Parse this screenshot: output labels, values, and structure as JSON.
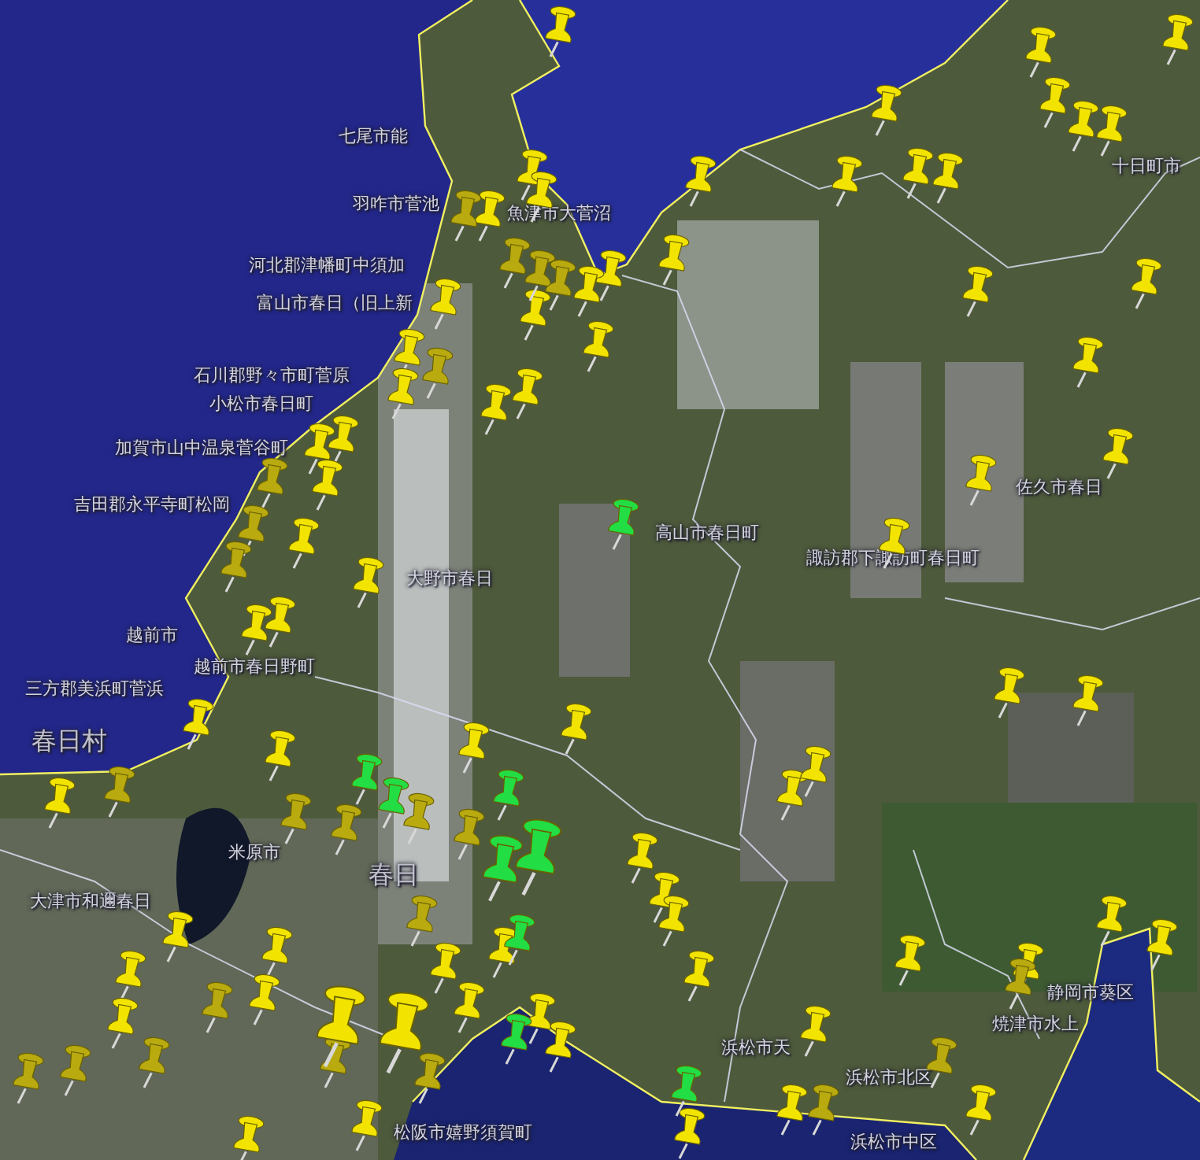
{
  "labels": [
    {
      "text": "七尾市能"
    },
    {
      "text": "羽咋市菅池"
    },
    {
      "text": "魚津市大菅沼"
    },
    {
      "text": "河北郡津幡町中須加"
    },
    {
      "text": "富山市春日（旧上新"
    },
    {
      "text": "石川郡野々市町菅原"
    },
    {
      "text": "小松市春日町"
    },
    {
      "text": "加賀市山中温泉菅谷町"
    },
    {
      "text": "吉田郡永平寺町松岡"
    },
    {
      "text": "大野市春日"
    },
    {
      "text": "越前市"
    },
    {
      "text": "越前市春日野町"
    },
    {
      "text": "三方郡美浜町菅浜"
    },
    {
      "text": "春日村"
    },
    {
      "text": "米原市"
    },
    {
      "text": "春日"
    },
    {
      "text": "大津市和邇春日"
    },
    {
      "text": "高山市春日町"
    },
    {
      "text": "諏訪郡下諏訪町春日町"
    },
    {
      "text": "佐久市春日"
    },
    {
      "text": "十日町市"
    },
    {
      "text": "焼津市水上"
    },
    {
      "text": "浜松市天"
    },
    {
      "text": "浜松市北区"
    },
    {
      "text": "浜松市中区"
    },
    {
      "text": "静岡市葵区"
    },
    {
      "text": "松阪市嬉野須賀町"
    }
  ],
  "pins": [
    {
      "color": "#f2e400"
    },
    {
      "color": "#f2e400"
    },
    {
      "color": "#f2e400"
    },
    {
      "color": "#f2e400"
    },
    {
      "color": "#f2e400"
    },
    {
      "color": "#f2e400"
    },
    {
      "color": "#f2e400"
    },
    {
      "color": "#f2e400"
    },
    {
      "color": "#f2e400"
    },
    {
      "color": "#f2e400"
    },
    {
      "color": "#f2e400"
    },
    {
      "color": "#f2e400"
    },
    {
      "color": "#f2e400"
    },
    {
      "color": "#f2e400"
    },
    {
      "color": "#f2e400"
    },
    {
      "color": "#f2e400"
    },
    {
      "color": "#f2e400"
    },
    {
      "color": "#f2e400"
    },
    {
      "color": "#f2e400"
    },
    {
      "color": "#f2e400"
    },
    {
      "color": "#f2e400"
    },
    {
      "color": "#f2e400"
    },
    {
      "color": "#f2e400"
    },
    {
      "color": "#f2e400"
    },
    {
      "color": "#f2e400"
    },
    {
      "color": "#f2e400"
    },
    {
      "color": "#f2e400"
    },
    {
      "color": "#f2e400"
    },
    {
      "color": "#f2e400"
    },
    {
      "color": "#f2e400"
    },
    {
      "color": "#f2e400"
    },
    {
      "color": "#f2e400"
    },
    {
      "color": "#f2e400"
    },
    {
      "color": "#f2e400"
    },
    {
      "color": "#f2e400"
    },
    {
      "color": "#f2e400"
    },
    {
      "color": "#f2e400"
    },
    {
      "color": "#f2e400"
    },
    {
      "color": "#f2e400"
    },
    {
      "color": "#f2e400"
    },
    {
      "color": "#f2e400"
    },
    {
      "color": "#f2e400"
    },
    {
      "color": "#f2e400"
    },
    {
      "color": "#f2e400"
    },
    {
      "color": "#f2e400"
    },
    {
      "color": "#f2e400"
    },
    {
      "color": "#f2e400"
    },
    {
      "color": "#f2e400"
    },
    {
      "color": "#f2e400"
    },
    {
      "color": "#f2e400"
    },
    {
      "color": "#f2e400"
    },
    {
      "color": "#f2e400"
    },
    {
      "color": "#f2e400"
    },
    {
      "color": "#f2e400"
    },
    {
      "color": "#f2e400"
    },
    {
      "color": "#f2e400"
    },
    {
      "color": "#f2e400"
    },
    {
      "color": "#f2e400"
    },
    {
      "color": "#f2e400"
    },
    {
      "color": "#f2e400"
    },
    {
      "color": "#f2e400"
    },
    {
      "color": "#f2e400"
    },
    {
      "color": "#f2e400"
    },
    {
      "color": "#f2e400"
    },
    {
      "color": "#f2e400"
    },
    {
      "color": "#f2e400"
    },
    {
      "color": "#f2e400"
    },
    {
      "color": "#f2e400"
    },
    {
      "color": "#f2e400"
    },
    {
      "color": "#f2e400"
    },
    {
      "color": "#b9aa10"
    },
    {
      "color": "#b9aa10"
    },
    {
      "color": "#b9aa10"
    },
    {
      "color": "#b9aa10"
    },
    {
      "color": "#b9aa10"
    },
    {
      "color": "#b9aa10"
    },
    {
      "color": "#b9aa10"
    },
    {
      "color": "#b9aa10"
    },
    {
      "color": "#b9aa10"
    },
    {
      "color": "#b9aa10"
    },
    {
      "color": "#b9aa10"
    },
    {
      "color": "#b9aa10"
    },
    {
      "color": "#b9aa10"
    },
    {
      "color": "#b9aa10"
    },
    {
      "color": "#b9aa10"
    },
    {
      "color": "#b9aa10"
    },
    {
      "color": "#b9aa10"
    },
    {
      "color": "#b9aa10"
    },
    {
      "color": "#b9aa10"
    },
    {
      "color": "#b9aa10"
    },
    {
      "color": "#b9aa10"
    },
    {
      "color": "#b9aa10"
    },
    {
      "color": "#b9aa10"
    },
    {
      "color": "#22dd44"
    },
    {
      "color": "#22dd44"
    },
    {
      "color": "#22dd44"
    },
    {
      "color": "#22dd44"
    },
    {
      "color": "#22dd44"
    },
    {
      "color": "#22dd44"
    },
    {
      "color": "#22dd44"
    },
    {
      "color": "#22dd44"
    },
    {
      "color": "#22dd44"
    },
    {
      "color": "#f2e400"
    },
    {
      "color": "#f2e400"
    }
  ]
}
